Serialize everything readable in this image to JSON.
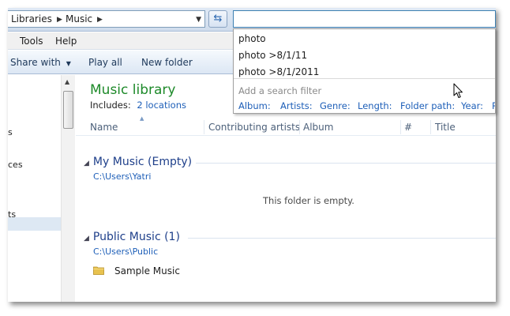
{
  "address": {
    "crumbs": [
      "Libraries",
      "Music"
    ],
    "arrow_glyph": "▶",
    "dropdown_glyph": "▼",
    "refresh_glyph": "⇆"
  },
  "search": {
    "value": ""
  },
  "menu": {
    "items": [
      "Tools",
      "Help"
    ]
  },
  "toolbar": {
    "share_with": "Share with",
    "share_caret": "▼",
    "play_all": "Play all",
    "new_folder": "New folder"
  },
  "nav": {
    "items": [
      "s",
      "ces",
      "ts"
    ],
    "scroll_up_glyph": "▲"
  },
  "library": {
    "title": "Music library",
    "includes_label": "Includes:",
    "includes_link": "2 locations"
  },
  "columns": [
    "Name",
    "Contributing artists",
    "Album",
    "#",
    "Title"
  ],
  "sort_glyph": "▲",
  "groups": [
    {
      "title": "My Music (Empty)",
      "path": "C:\\Users\\Yatri",
      "caret": "◢"
    },
    {
      "title": "Public Music (1)",
      "path": "C:\\Users\\Public",
      "caret": "◢"
    }
  ],
  "empty_message": "This folder is empty.",
  "files": [
    {
      "name": "Sample Music",
      "icon": "folder-icon"
    }
  ],
  "suggestions": {
    "items": [
      "photo",
      "photo >8/1/11",
      "photo >8/1/2011"
    ],
    "filter_title": "Add a search filter",
    "filters": [
      "Album:",
      "Artists:",
      "Genre:",
      "Length:",
      "Folder path:",
      "Year:",
      "R"
    ]
  },
  "colors": {
    "library_title": "#1e8a2a",
    "link": "#1e5fb8",
    "group_title": "#1e3f8a",
    "search_border": "#3c7fb1"
  }
}
